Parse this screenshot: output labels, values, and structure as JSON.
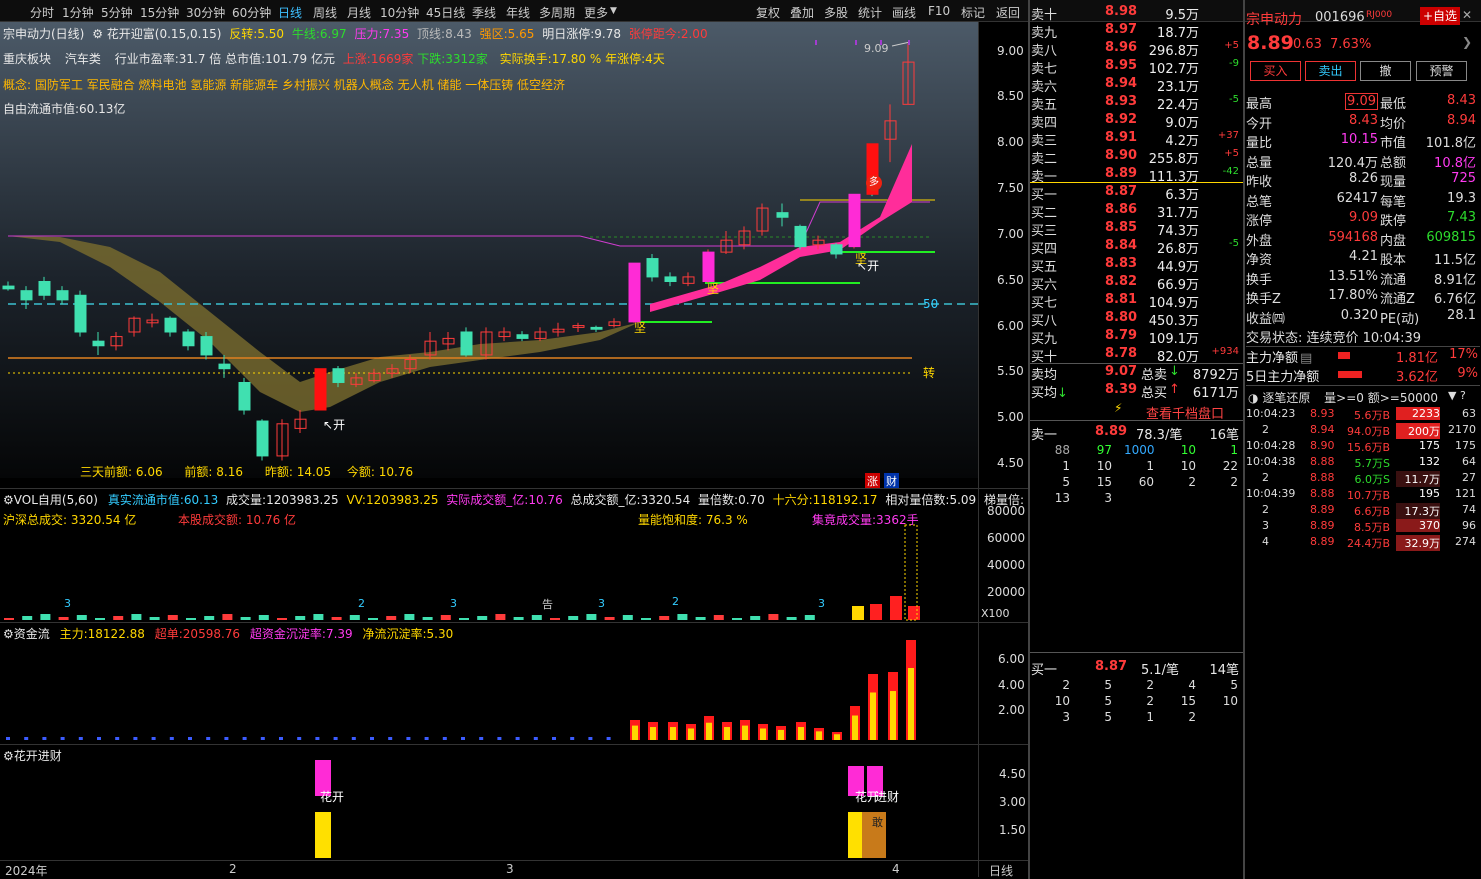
{
  "toolbar": {
    "left": [
      "分时",
      "1分钟",
      "5分钟",
      "15分钟",
      "30分钟",
      "60分钟",
      "日线",
      "周线",
      "月线",
      "10分钟",
      "45日线",
      "季线",
      "年线",
      "多周期",
      "更多"
    ],
    "active": "日线",
    "right": [
      "复权",
      "叠加",
      "多股",
      "统计",
      "画线",
      "F10",
      "标记",
      "返回"
    ]
  },
  "chart_head": {
    "name": "宗申动力(日线)",
    "indicator": "花开迎富(0.15,0.15)",
    "fz_label": "反转:",
    "fz": "5.50",
    "nx_label": "牛线:",
    "nx": "6.97",
    "yl_label": "压力:",
    "yl": "7.35",
    "dx_label": "顶线:",
    "dx": "8.43",
    "qq_label": "强区:",
    "qq": "5.65",
    "mrzt": "明日涨停:",
    "mrzt_v": "9.78",
    "ztjl": "张停距今:",
    "ztjl_v": "2.00"
  },
  "info": {
    "sector": "重庆板块",
    "industry": "汽车类",
    "pe_label": "行业市盈率:",
    "pe": "31.7 倍",
    "cap_label": "总市值:",
    "cap": "101.79 亿元",
    "up": "上涨:1669家",
    "down_label": "下跌:",
    "down": "3312家",
    "turn_label": "实际换手:",
    "turn": "17.80 %",
    "ztn": "年涨停:4天",
    "concepts_label": "概念:",
    "concepts": "国防军工 军民融合 燃料电池 氢能源 新能源车 乡村振兴 机器人概念 无人机 储能 一体压铸 低空经济",
    "float_label": "自由流通市值:",
    "float": "60.13亿"
  },
  "price_axis": [
    "9.00",
    "8.50",
    "8.00",
    "7.50",
    "7.00",
    "6.50",
    "6.00",
    "5.50",
    "5.00",
    "4.50"
  ],
  "main_labels": {
    "high": "9.09",
    "kai1": "开",
    "kai2": "开",
    "jian1": "坚",
    "jian2": "坚",
    "jian3": "坚",
    "duo": "多",
    "zhuan": "转",
    "fifty": "50",
    "zhang": "涨",
    "cai": "财"
  },
  "bottom_info": {
    "s3": "三天前额:",
    "s3v": "6.06",
    "qe": "前额:",
    "qev": "8.16",
    "ze": "昨额:",
    "zev": "14.05",
    "je": "今额:",
    "jev": "10.76"
  },
  "vol": {
    "title": "VOL自用(5,60)",
    "z1": "真实流通市值:",
    "z1v": "60.13",
    "z2": "成交量:",
    "z2v": "1203983.25",
    "z3": "VV:",
    "z3v": "1203983.25",
    "z4": "实际成交额_亿:",
    "z4v": "10.76",
    "z5": "总成交额_亿:",
    "z5v": "3320.54",
    "z6": "量倍数:",
    "z6v": "0.70",
    "z7": "十六分:",
    "z7v": "118192.17",
    "z8": "相对量倍数:",
    "z8v": "5.09",
    "z9": "梯量倍:",
    "hs": "沪深总成交:",
    "hsv": "3320.54 亿",
    "bg": "本股成交额:",
    "bgv": "10.76 亿",
    "bh": "量能饱和度:",
    "bhv": "76.3 %",
    "jj": "集竟成交量:",
    "jjv": "3362手",
    "axis": [
      "80000",
      "60000",
      "40000",
      "20000"
    ],
    "x100": "X100",
    "nums": [
      "3",
      "2",
      "3",
      "3",
      "2",
      "3"
    ],
    "gao": "告"
  },
  "zjl": {
    "title": "资金流",
    "zl": "主力:",
    "zlv": "18122.88",
    "cd": "超单:",
    "cdv": "20598.76",
    "cz": "超资金沉淀率:",
    "czv": "7.39",
    "jl": "净流沉淀率:",
    "jlv": "5.30",
    "axis": [
      "6.00",
      "4.00",
      "2.00"
    ]
  },
  "hk": {
    "title": "花开进财",
    "axis": [
      "4.50",
      "3.00",
      "1.50"
    ],
    "l1": "花开",
    "l2": "花开",
    "l3": "进财",
    "l4": "敢"
  },
  "dates": {
    "d1": "2024年",
    "d2": "2",
    "d3": "3",
    "d4": "4",
    "period": "日线"
  },
  "orderbook": {
    "sells": [
      {
        "l": "卖十",
        "p": "8.98",
        "v": "9.5万",
        "d": ""
      },
      {
        "l": "卖九",
        "p": "8.97",
        "v": "18.7万",
        "d": ""
      },
      {
        "l": "卖八",
        "p": "8.96",
        "v": "296.8万",
        "d": "+5"
      },
      {
        "l": "卖七",
        "p": "8.95",
        "v": "102.7万",
        "d": "-9"
      },
      {
        "l": "卖六",
        "p": "8.94",
        "v": "23.1万",
        "d": ""
      },
      {
        "l": "卖五",
        "p": "8.93",
        "v": "22.4万",
        "d": "-5"
      },
      {
        "l": "卖四",
        "p": "8.92",
        "v": "9.0万",
        "d": ""
      },
      {
        "l": "卖三",
        "p": "8.91",
        "v": "4.2万",
        "d": "+37"
      },
      {
        "l": "卖二",
        "p": "8.90",
        "v": "255.8万",
        "d": "+5"
      },
      {
        "l": "卖一",
        "p": "8.89",
        "v": "111.3万",
        "d": "-42"
      }
    ],
    "buys": [
      {
        "l": "买一",
        "p": "8.87",
        "v": "6.3万",
        "d": ""
      },
      {
        "l": "买二",
        "p": "8.86",
        "v": "31.7万",
        "d": ""
      },
      {
        "l": "买三",
        "p": "8.85",
        "v": "74.3万",
        "d": ""
      },
      {
        "l": "买四",
        "p": "8.84",
        "v": "26.8万",
        "d": "-5"
      },
      {
        "l": "买五",
        "p": "8.83",
        "v": "44.9万",
        "d": ""
      },
      {
        "l": "买六",
        "p": "8.82",
        "v": "66.9万",
        "d": ""
      },
      {
        "l": "买七",
        "p": "8.81",
        "v": "104.9万",
        "d": ""
      },
      {
        "l": "买八",
        "p": "8.80",
        "v": "450.3万",
        "d": ""
      },
      {
        "l": "买九",
        "p": "8.79",
        "v": "109.1万",
        "d": ""
      },
      {
        "l": "买十",
        "p": "8.78",
        "v": "82.0万",
        "d": "+934"
      }
    ],
    "avg_sell_l": "卖均",
    "avg_sell": "9.07",
    "tot_sell_l": "总卖",
    "tot_sell": "8792万",
    "avg_buy_l": "买均",
    "avg_buy": "8.39",
    "tot_buy_l": "总买",
    "tot_buy": "6171万",
    "link": "查看千档盘口",
    "s1": {
      "l": "卖一",
      "p": "8.89",
      "v": "78.3/笔",
      "n": "16笔",
      "grid": [
        [
          "88",
          "97",
          "1000",
          "10",
          "1"
        ],
        [
          "1",
          "10",
          "1",
          "10",
          "22"
        ],
        [
          "5",
          "15",
          "60",
          "2",
          "2"
        ],
        [
          "13",
          "3",
          "",
          "",
          ""
        ]
      ]
    },
    "b1": {
      "l": "买一",
      "p": "8.87",
      "v": "5.1/笔",
      "n": "14笔",
      "grid": [
        [
          "2",
          "5",
          "2",
          "4",
          "5"
        ],
        [
          "10",
          "5",
          "2",
          "15",
          "10"
        ],
        [
          "3",
          "5",
          "1",
          "2",
          ""
        ]
      ]
    }
  },
  "quote": {
    "name": "宗申动力",
    "code": "001696",
    "tag": "RJ000",
    "fav": "+自选",
    "price": "8.89",
    "chg": "0.63",
    "pct": "7.63%",
    "btns": [
      "买入",
      "卖出",
      "撤",
      "预警"
    ],
    "rows": [
      [
        "最高",
        "9.09",
        "最低",
        "8.43"
      ],
      [
        "今开",
        "8.43",
        "均价",
        "8.94"
      ],
      [
        "量比",
        "10.15",
        "市值",
        "101.8亿"
      ],
      [
        "总量",
        "120.4万",
        "总额",
        "10.8亿"
      ],
      [
        "昨收",
        "8.26",
        "现量",
        "725"
      ],
      [
        "总笔",
        "62417",
        "每笔",
        "19.3"
      ],
      [
        "涨停",
        "9.09",
        "跌停",
        "7.43"
      ],
      [
        "外盘",
        "594168",
        "内盘",
        "609815"
      ],
      [
        "净资",
        "4.21",
        "股本",
        "11.5亿"
      ],
      [
        "换手",
        "13.51%",
        "流通",
        "8.91亿"
      ],
      [
        "换手Z",
        "17.80%",
        "流通Z",
        "6.76亿"
      ],
      [
        "收益㈣",
        "0.320",
        "PE(动)",
        "28.1"
      ]
    ],
    "state": "交易状态: 连续竞价 10:04:39",
    "zl_l": "主力净额",
    "zl_v": "1.81亿",
    "zl_p": "17%",
    "zl5_l": "5日主力净额",
    "zl5_v": "3.62亿",
    "zl5_p": "9%"
  },
  "ticks": {
    "title": "逐笔还原",
    "filter": "量>=0 额>=50000",
    "rows": [
      [
        "10:04:23",
        "8.93",
        "5.6万B",
        "2233",
        "63"
      ],
      [
        "2",
        "8.94",
        "94.0万B",
        "200万",
        "2170"
      ],
      [
        "10:04:28",
        "8.90",
        "15.6万B",
        "175",
        "175"
      ],
      [
        "10:04:38",
        "8.88",
        "5.7万S",
        "132",
        "64"
      ],
      [
        "2",
        "8.88",
        "6.0万S",
        "11.7万",
        "27"
      ],
      [
        "10:04:39",
        "8.88",
        "10.7万B",
        "195",
        "121"
      ],
      [
        "2",
        "8.89",
        "6.6万B",
        "17.3万",
        "74"
      ],
      [
        "3",
        "8.89",
        "8.5万B",
        "370",
        "96"
      ],
      [
        "4",
        "8.89",
        "24.4万B",
        "32.9万",
        "274"
      ]
    ]
  }
}
